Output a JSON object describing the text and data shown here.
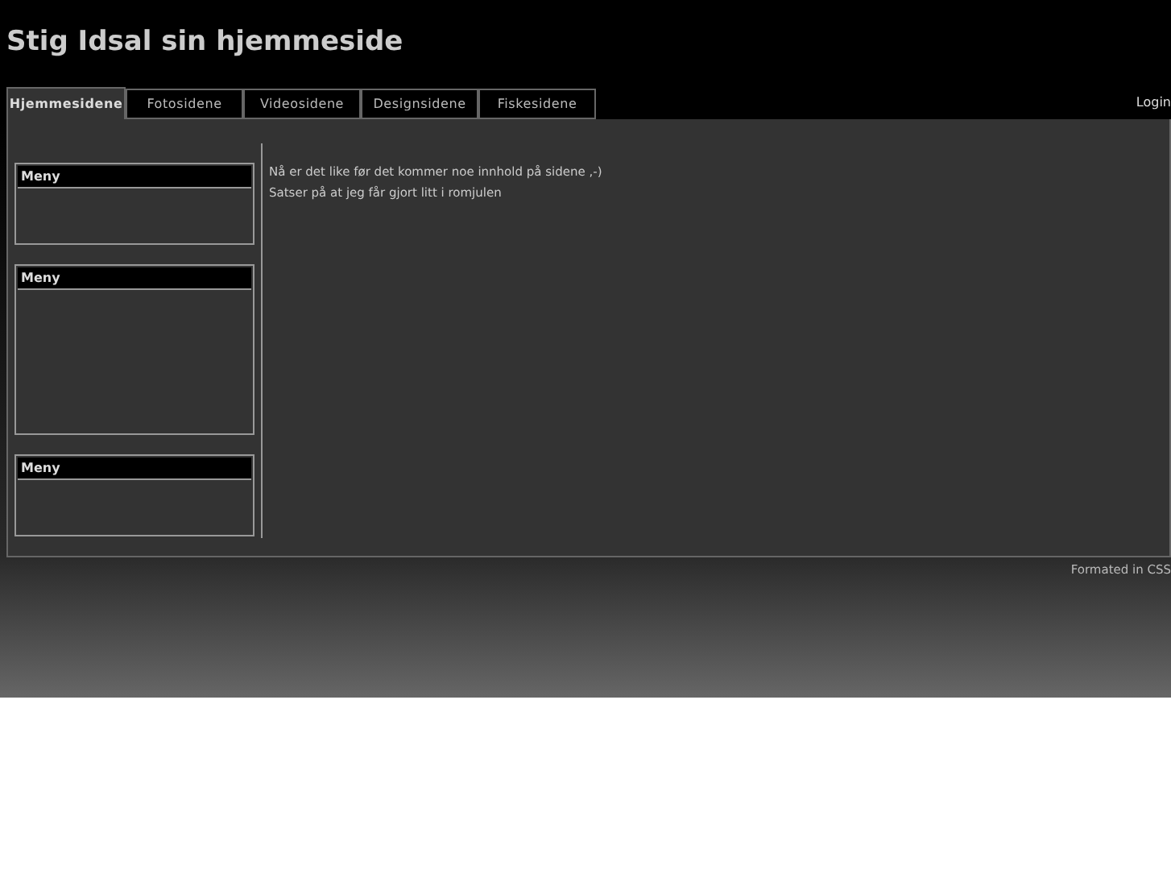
{
  "header": {
    "title": "Stig Idsal sin hjemmeside",
    "login": "Login"
  },
  "tabs": [
    {
      "label": "Hjemmesidene",
      "selected": true
    },
    {
      "label": "Fotosidene",
      "selected": false
    },
    {
      "label": "Videosidene",
      "selected": false
    },
    {
      "label": "Designsidene",
      "selected": false
    },
    {
      "label": "Fiskesidene",
      "selected": false
    }
  ],
  "sidebar": {
    "boxes": [
      {
        "title": "Meny",
        "kind": "short"
      },
      {
        "title": "Meny",
        "kind": "tall"
      },
      {
        "title": "Meny",
        "kind": "short"
      }
    ]
  },
  "content": {
    "lines": [
      "Nå er det like før det kommer noe innhold på sidene ,-)",
      "Satser på at jeg får gjort litt i romjulen"
    ]
  },
  "footer": {
    "text": "Formated in CSS"
  }
}
